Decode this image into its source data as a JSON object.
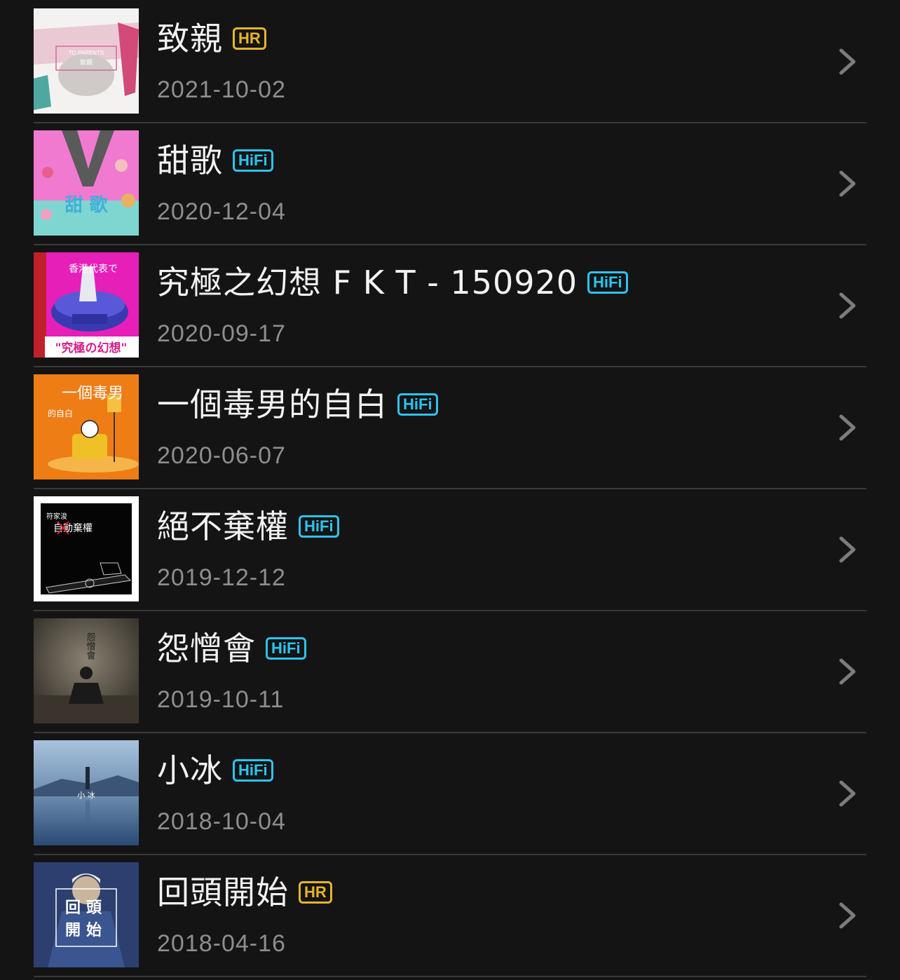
{
  "albums": [
    {
      "title": "致親",
      "badge": "HR",
      "date": "2021-10-02"
    },
    {
      "title": "甜歌",
      "badge": "HiFi",
      "date": "2020-12-04"
    },
    {
      "title": "究極之幻想 F K T - 150920",
      "badge": "HiFi",
      "date": "2020-09-17"
    },
    {
      "title": "一個毒男的自白",
      "badge": "HiFi",
      "date": "2020-06-07"
    },
    {
      "title": "絕不棄權",
      "badge": "HiFi",
      "date": "2019-12-12"
    },
    {
      "title": "怨憎會",
      "badge": "HiFi",
      "date": "2019-10-11"
    },
    {
      "title": "小冰",
      "badge": "HiFi",
      "date": "2018-10-04"
    },
    {
      "title": "回頭開始",
      "badge": "HR",
      "date": "2018-04-16"
    }
  ],
  "cover_text": {
    "a1": "TO PARENTS",
    "a1b": "致親",
    "a2": "甜 歌",
    "a3": "香港代表で",
    "a3b": "\"究極の幻想\"",
    "a4": "一個毒男",
    "a4b": "的自白",
    "a5": "符家浚",
    "a5b": "自動棄權",
    "a6": "怨憎會",
    "a7": "小 冰",
    "a8": "回頭",
    "a8b": "開始"
  },
  "colors": {
    "hr": "#e6b42a",
    "hifi": "#2ec3ee",
    "background": "#141414"
  },
  "icons": {
    "chevron": "chevron-right-icon"
  }
}
